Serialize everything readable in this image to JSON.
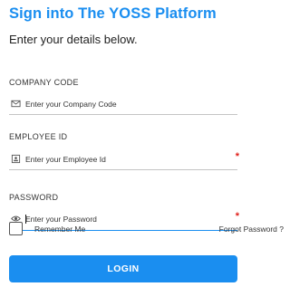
{
  "header": {
    "title": "Sign into The YOSS Platform",
    "subtitle": "Enter your details below."
  },
  "form": {
    "company_code": {
      "label": "COMPANY CODE",
      "placeholder": "Enter your Company Code",
      "icon": "envelope-icon",
      "required": false
    },
    "employee_id": {
      "label": "EMPLOYEE ID",
      "placeholder": "Enter your Employee Id",
      "icon": "id-card-icon",
      "required": true,
      "required_marker": "*"
    },
    "password": {
      "label": "PASSWORD",
      "placeholder": "Enter your Password",
      "icon": "eye-icon",
      "required": true,
      "required_marker": "*",
      "focused": true
    },
    "remember_me": {
      "label": "Remember Me",
      "checked": false
    },
    "forgot_password": "Forgot Password ?",
    "login_label": "LOGIN"
  },
  "colors": {
    "accent": "#1a8ef0",
    "required": "#e0201b",
    "text": "#222222"
  }
}
